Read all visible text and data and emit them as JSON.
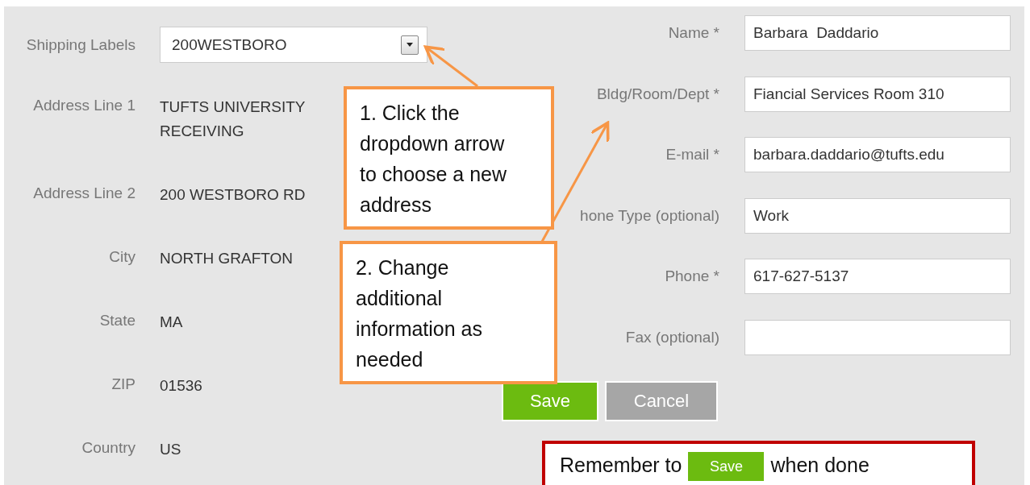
{
  "shipping": {
    "label": "Shipping Labels",
    "value": "200WESTBORO"
  },
  "address": [
    {
      "label": "Address Line 1",
      "value": "TUFTS UNIVERSITY RECEIVING"
    },
    {
      "label": "Address Line 2",
      "value": "200 WESTBORO RD"
    },
    {
      "label": "City",
      "value": "NORTH GRAFTON"
    },
    {
      "label": "State",
      "value": "MA"
    },
    {
      "label": "ZIP",
      "value": "01536"
    },
    {
      "label": "Country",
      "value": "US"
    }
  ],
  "contact_fields": [
    {
      "label": "Name *",
      "value": "Barbara  Daddario"
    },
    {
      "label": "Bldg/Room/Dept *",
      "value": "Fiancial Services Room 310"
    },
    {
      "label": "E-mail *",
      "value": "barbara.daddario@tufts.edu"
    },
    {
      "label": "hone Type (optional)",
      "value": "Work"
    },
    {
      "label": "Phone *",
      "value": "617-627-5137"
    },
    {
      "label": "Fax (optional)"
    }
  ],
  "buttons": [
    {
      "label": "Save",
      "kind": "primary"
    },
    {
      "label": "Cancel",
      "kind": "secondary"
    }
  ],
  "callouts": [
    {
      "text": "1. Click the dropdown arrow to choose a new address"
    },
    {
      "text": "2. Change additional information as needed"
    }
  ],
  "reminder": {
    "before": "Remember to",
    "button": "Save",
    "after": "when done"
  }
}
